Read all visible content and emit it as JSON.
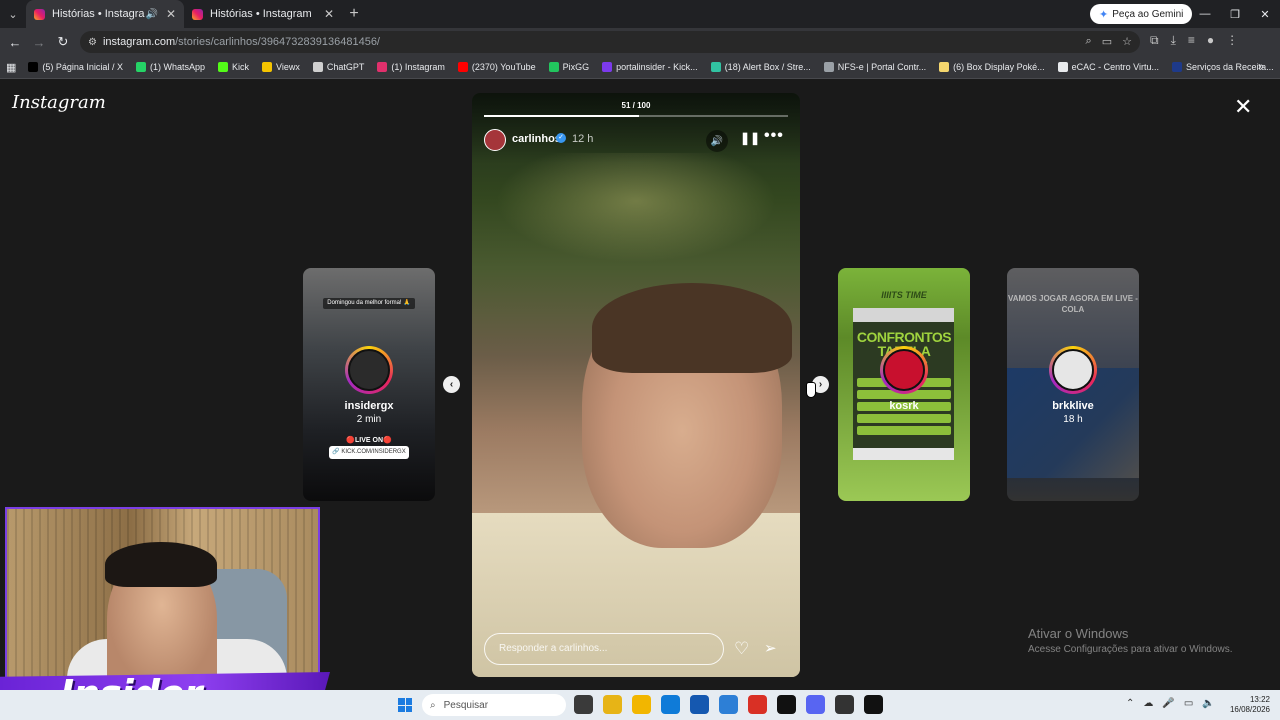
{
  "browser": {
    "tabs": [
      {
        "title": "Histórias • Instagram",
        "active": true
      },
      {
        "title": "Histórias • Instagram",
        "active": false
      }
    ],
    "gemini_button": "Peça ao Gemini",
    "url_host": "instagram.com",
    "url_path": "/stories/carlinhos/3964732839136481456/",
    "bookmarks": [
      {
        "label": "(5) Página Inicial / X",
        "color": "#000000"
      },
      {
        "label": "(1) WhatsApp",
        "color": "#25d366"
      },
      {
        "label": "Kick",
        "color": "#53fc18"
      },
      {
        "label": "Viewx",
        "color": "#f5c400"
      },
      {
        "label": "ChatGPT",
        "color": "#cfcfcf"
      },
      {
        "label": "(1) Instagram",
        "color": "#e1306c"
      },
      {
        "label": "(2370) YouTube",
        "color": "#ff0000"
      },
      {
        "label": "PixGG",
        "color": "#22c55e"
      },
      {
        "label": "portalinsider - Kick...",
        "color": "#7c3aed"
      },
      {
        "label": "(18) Alert Box / Stre...",
        "color": "#31c3a2"
      },
      {
        "label": "NFS-e | Portal Contr...",
        "color": "#9aa0a6"
      },
      {
        "label": "(6) Box Display Poké...",
        "color": "#f5d76e"
      },
      {
        "label": "eCAC - Centro Virtu...",
        "color": "#e8eaed"
      },
      {
        "label": "Serviços da Receita...",
        "color": "#1e3a8a"
      }
    ]
  },
  "instagram": {
    "logo": "Instagram",
    "side_stories": [
      {
        "user": "insidergx",
        "time": "2 min",
        "caption": "Domingou da melhor forma! 🙏",
        "live_label": "🔴LIVE ON🔴",
        "kick_link": "🔗 KICK.COM/INSIDERGX"
      },
      {
        "user": "kosrk",
        "header": "IIIITS TIME",
        "card_title": "CONFRONTOS TABELA JOGOS"
      },
      {
        "user": "brkklive",
        "time": "18 h",
        "header": "VAMOS JOGAR AGORA EM LIVE - COLA"
      }
    ],
    "story": {
      "counter": "51 / 100",
      "progress": 0.51,
      "user": "carlinhos",
      "time": "12 h",
      "reply_placeholder": "Responder a carlinhos..."
    }
  },
  "windows_activation": {
    "title": "Ativar o Windows",
    "subtitle": "Acesse Configurações para ativar o Windows."
  },
  "overlay": {
    "brand": "Insider"
  },
  "taskbar": {
    "search_placeholder": "Pesquisar",
    "time": "13:22",
    "date": "16/08/2026",
    "apps": [
      "#3a3a3a",
      "#e7b416",
      "#f2b600",
      "#0f7bd8",
      "#1558b0",
      "#2d7fd6",
      "#d93025",
      "#111111",
      "#5865f2",
      "#333333",
      "#111111"
    ]
  }
}
